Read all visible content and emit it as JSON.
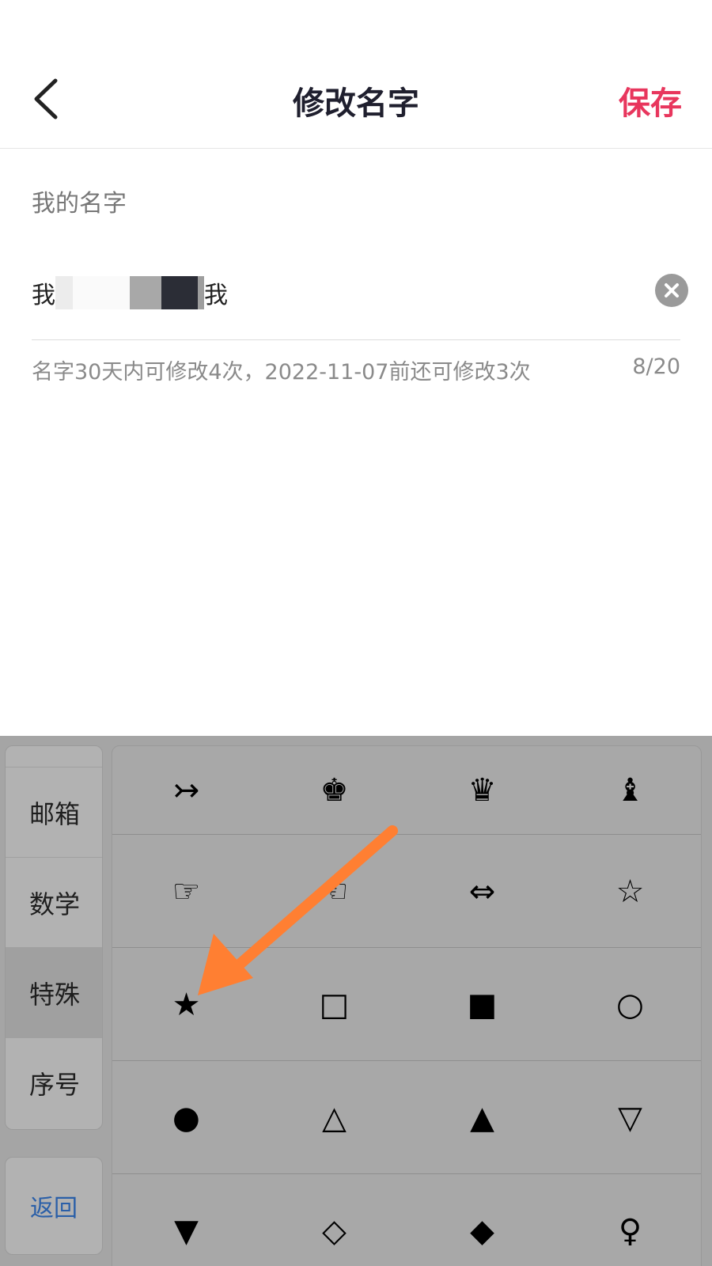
{
  "header": {
    "title": "修改名字",
    "save_label": "保存"
  },
  "form": {
    "label": "我的名字",
    "name_start": "我",
    "name_end": "我",
    "hint": "名字30天内可修改4次，2022-11-07前还可修改3次",
    "count": "8/20"
  },
  "keyboard": {
    "categories": [
      "邮箱",
      "数学",
      "特殊",
      "序号"
    ],
    "active_category": "特殊",
    "back_label": "返回",
    "symbols": [
      "↣",
      "♚",
      "♛",
      "♝",
      "☞",
      "☜",
      "⇔",
      "☆",
      "★",
      "□",
      "■",
      "○",
      "●",
      "△",
      "▲",
      "▽",
      "▼",
      "◇",
      "◆",
      "♀"
    ]
  },
  "colors": {
    "accent": "#e8365d",
    "arrow": "#ff7f32",
    "keyboard_bg": "#a5a5a5"
  }
}
